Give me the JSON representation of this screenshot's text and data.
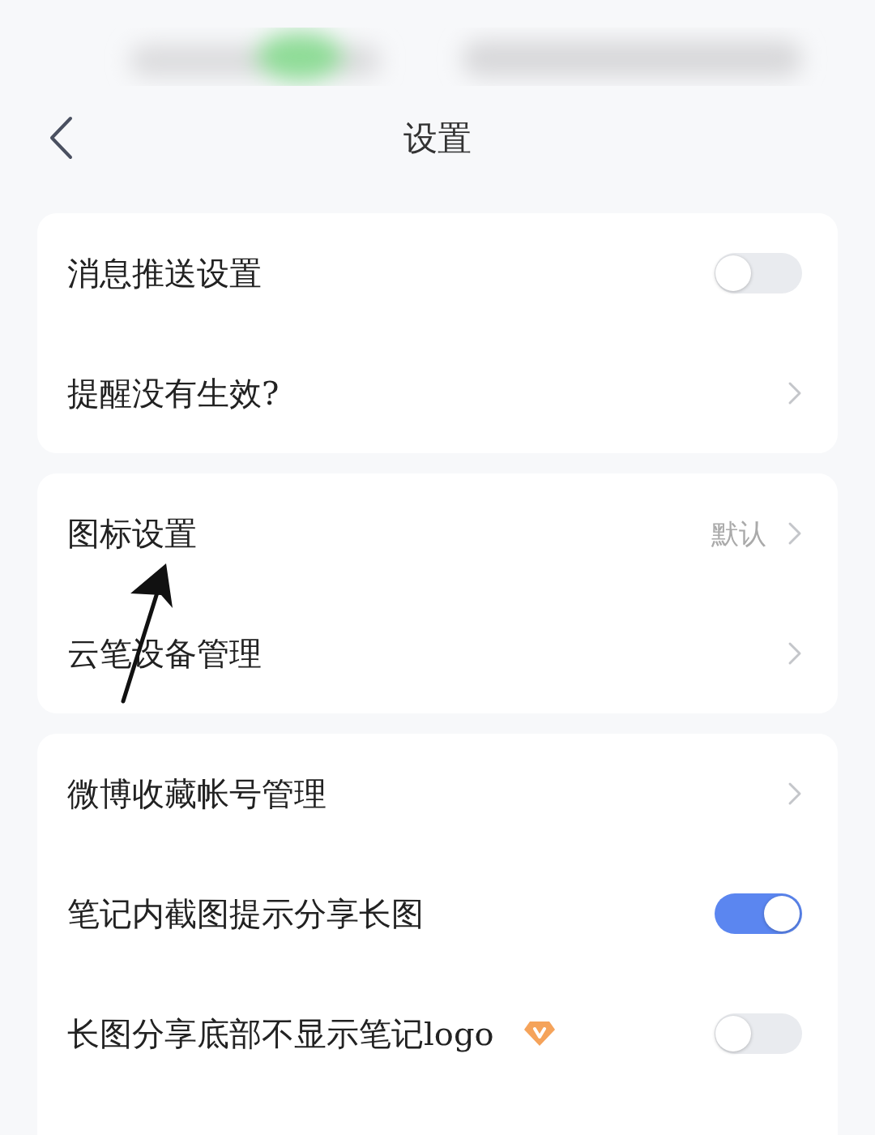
{
  "header": {
    "title": "设置"
  },
  "groups": [
    {
      "items": [
        {
          "kind": "toggle",
          "label": "消息推送设置",
          "on": false,
          "vip_badge": false
        },
        {
          "kind": "link",
          "label": "提醒没有生效?",
          "vip_badge": false
        }
      ]
    },
    {
      "items": [
        {
          "kind": "link",
          "label": "图标设置",
          "value": "默认",
          "vip_badge": false
        },
        {
          "kind": "link",
          "label": "云笔设备管理",
          "vip_badge": false
        }
      ]
    },
    {
      "items": [
        {
          "kind": "link",
          "label": "微博收藏帐号管理",
          "vip_badge": false
        },
        {
          "kind": "toggle",
          "label": "笔记内截图提示分享长图",
          "on": true,
          "vip_badge": false
        },
        {
          "kind": "toggle",
          "label": "长图分享底部不显示笔记logo",
          "on": false,
          "vip_badge": true
        }
      ]
    }
  ]
}
